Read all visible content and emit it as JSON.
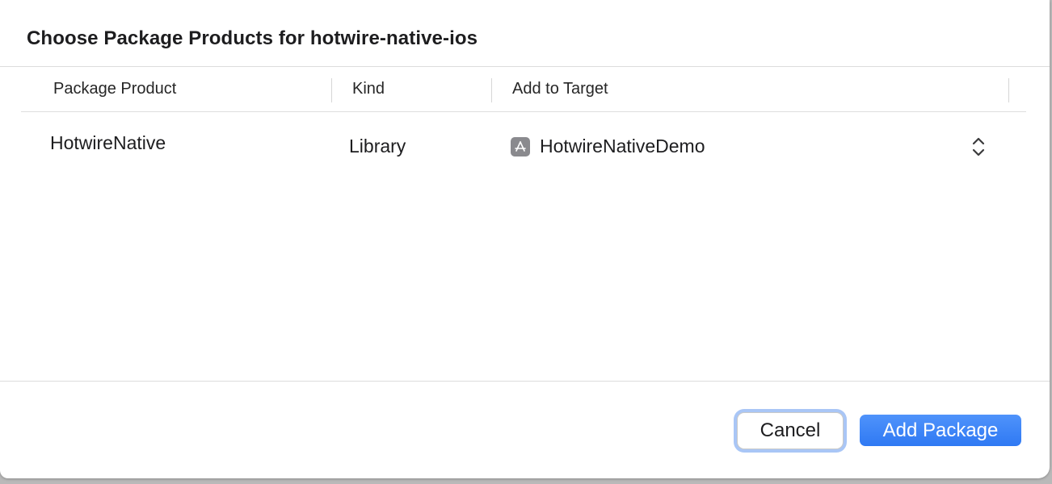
{
  "dialog": {
    "title": "Choose Package Products for hotwire-native-ios"
  },
  "table": {
    "columns": [
      "Package Product",
      "Kind",
      "Add to Target"
    ],
    "rows": [
      {
        "product": "HotwireNative",
        "kind": "Library",
        "target": "HotwireNativeDemo",
        "target_icon": "app-target-icon"
      }
    ]
  },
  "buttons": {
    "cancel_label": "Cancel",
    "add_label": "Add Package"
  },
  "colors": {
    "accent": "#2f79f3",
    "focus_ring": "#a9c6f6",
    "target_icon": "#8a8a8e"
  }
}
